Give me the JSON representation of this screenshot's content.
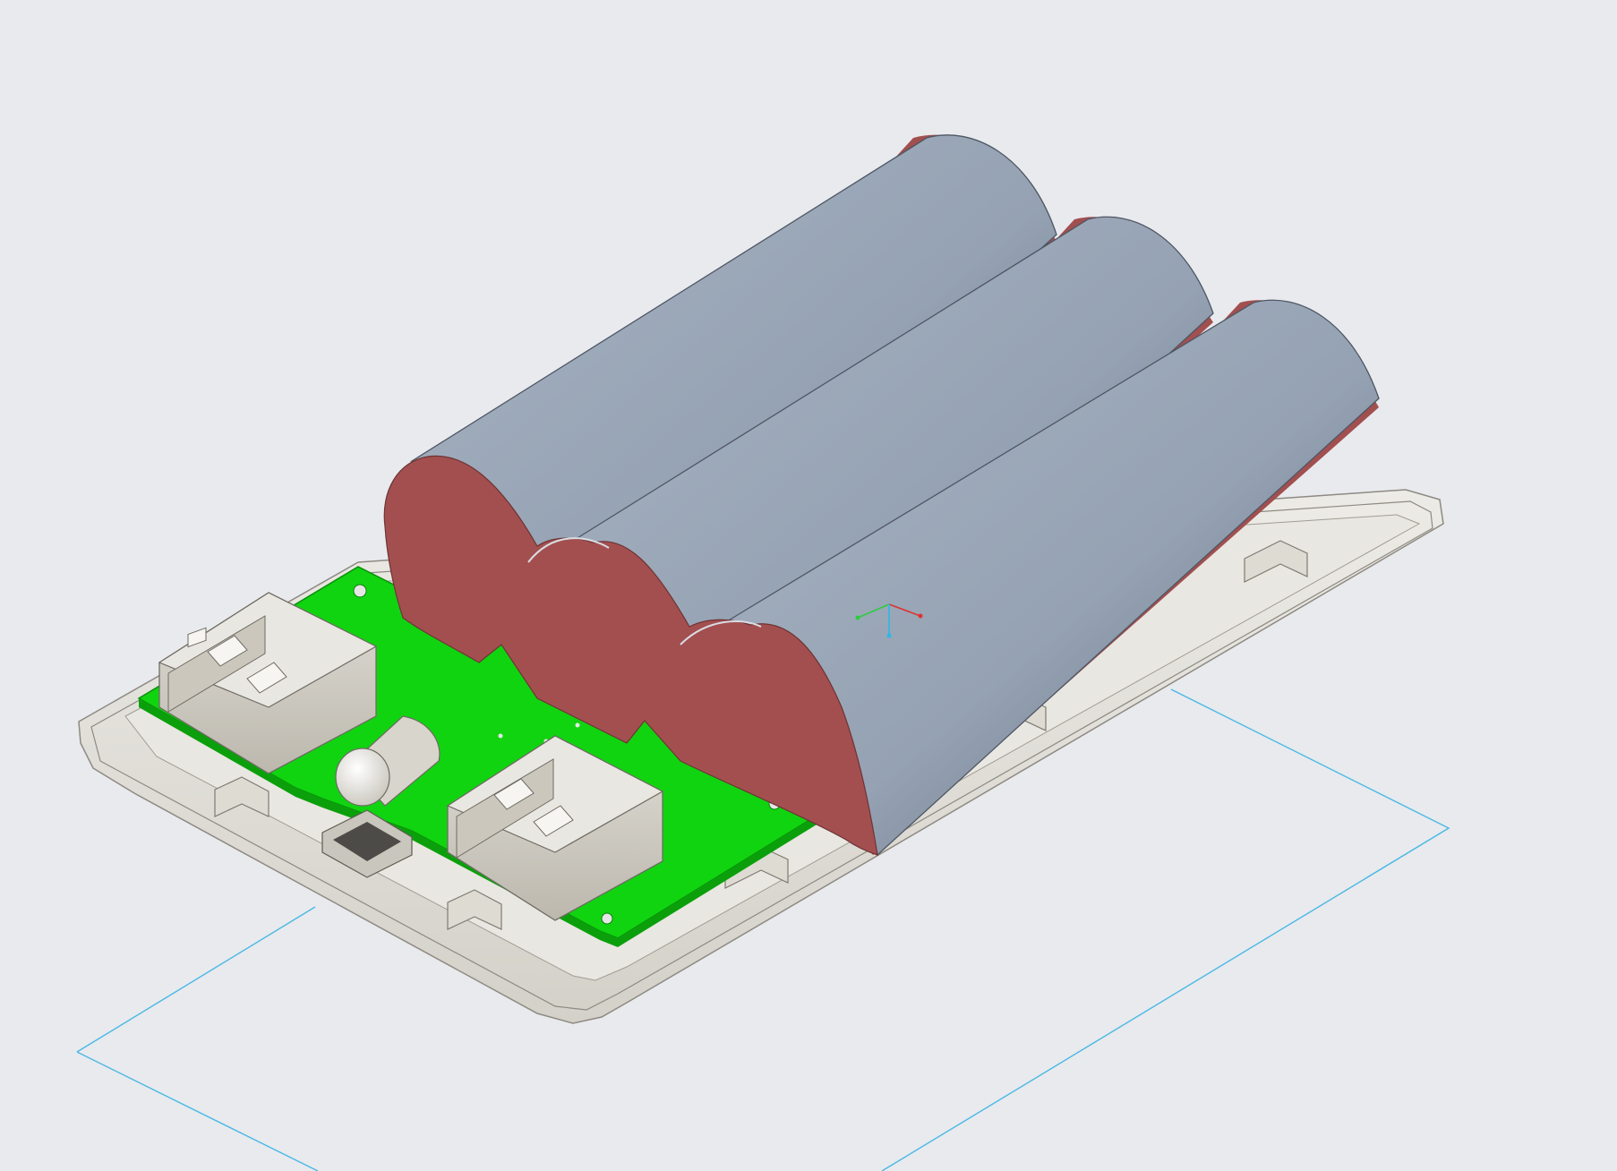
{
  "viewport": {
    "background": "#e8eaee",
    "description_visible_text": ""
  },
  "colors": {
    "battery_body": "#97a4b4",
    "battery_shadow": "#5b6472",
    "battery_cap": "#a14f4f",
    "pcb": "#13d413",
    "pcb_edge": "#0aa30a",
    "enclosure": "#e2dfd6",
    "enclosure_edge": "#8f8b82",
    "connector": "#d4d1c8",
    "sketch_line": "#48b8e6",
    "triad_x": "#e03131",
    "triad_y": "#2ecc40",
    "triad_z": "#2bb8e6"
  },
  "model": {
    "batteries": 3,
    "usb_ports": 2,
    "micro_usb_ports": 1,
    "led_count": 1
  },
  "icons": {
    "triad": "coordinate-triad-icon"
  }
}
